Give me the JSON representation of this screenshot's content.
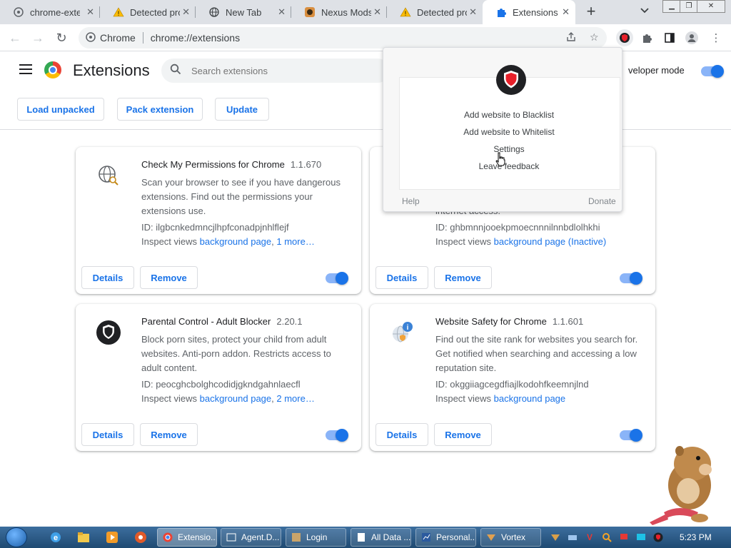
{
  "browser": {
    "tabs": [
      {
        "title": "chrome-exte",
        "icon": "chrome-page-icon",
        "active": false
      },
      {
        "title": "Detected pro",
        "icon": "warning-icon",
        "active": false
      },
      {
        "title": "New Tab",
        "icon": "globe-icon",
        "active": false
      },
      {
        "title": "Nexus Mods",
        "icon": "nexus-mods-icon",
        "active": false
      },
      {
        "title": "Detected pro",
        "icon": "warning-icon",
        "active": false
      },
      {
        "title": "Extensions",
        "icon": "puzzle-icon",
        "active": true
      }
    ],
    "omnibox": {
      "site_name": "Chrome",
      "url": "chrome://extensions"
    }
  },
  "header": {
    "title": "Extensions",
    "search_placeholder": "Search extensions",
    "developer_mode_label": "veloper mode",
    "developer_mode_on": true,
    "buttons": {
      "load_unpacked": "Load unpacked",
      "pack_extension": "Pack extension",
      "update": "Update"
    }
  },
  "extensions": [
    {
      "name": "Check My Permissions for Chrome",
      "version": "1.1.670",
      "description": "Scan your browser to see if you have dangerous extensions. Find out the permissions your extensions use.",
      "id": "ID: ilgbcnkedmncjlhpfconadpjnhlflejf",
      "inspect_label": "Inspect views",
      "links": [
        "background page",
        "1 more…"
      ],
      "enabled": true,
      "details_label": "Details",
      "remove_label": "Remove"
    },
    {
      "name": "",
      "version": "",
      "description": "",
      "partial_text": "internet access.",
      "id": "ID: ghbmnnjooekpmoecnnnilnnbdlolhkhi",
      "inspect_label": "Inspect views",
      "links": [
        "background page (Inactive)"
      ],
      "enabled": true,
      "details_label": "Details",
      "remove_label": "Remove"
    },
    {
      "name": "Parental Control - Adult Blocker",
      "version": "2.20.1",
      "description": "Block porn sites, protect your child from adult websites. Anti-porn addon. Restricts access to adult content.",
      "id": "ID: peocghcbolghcodidjgkndgahnlaecfl",
      "inspect_label": "Inspect views",
      "links": [
        "background page",
        "2 more…"
      ],
      "enabled": true,
      "details_label": "Details",
      "remove_label": "Remove"
    },
    {
      "name": "Website Safety for Chrome",
      "version": "1.1.601",
      "description": "Find out the site rank for websites you search for. Get notified when searching and accessing a low reputation site.",
      "id": "ID: okggiiagcegdfiajlkodohfkeemnjlnd",
      "inspect_label": "Inspect views",
      "links": [
        "background page"
      ],
      "enabled": true,
      "details_label": "Details",
      "remove_label": "Remove"
    }
  ],
  "popup": {
    "items": [
      "Add website to Blacklist",
      "Add website to Whitelist",
      "Settings",
      "Leave feedback"
    ],
    "footer_help": "Help",
    "footer_donate": "Donate"
  },
  "taskbar": {
    "tasks": [
      "Extensio...",
      "Agent.D...",
      "Login",
      "All Data ...",
      "Personal...",
      "Vortex"
    ],
    "clock": "5:23 PM"
  },
  "colors": {
    "accent": "#1a73e8",
    "toggle_track": "#8ab4f8",
    "tabstrip": "#dee1e6",
    "taskbar": "#1f4a72"
  }
}
